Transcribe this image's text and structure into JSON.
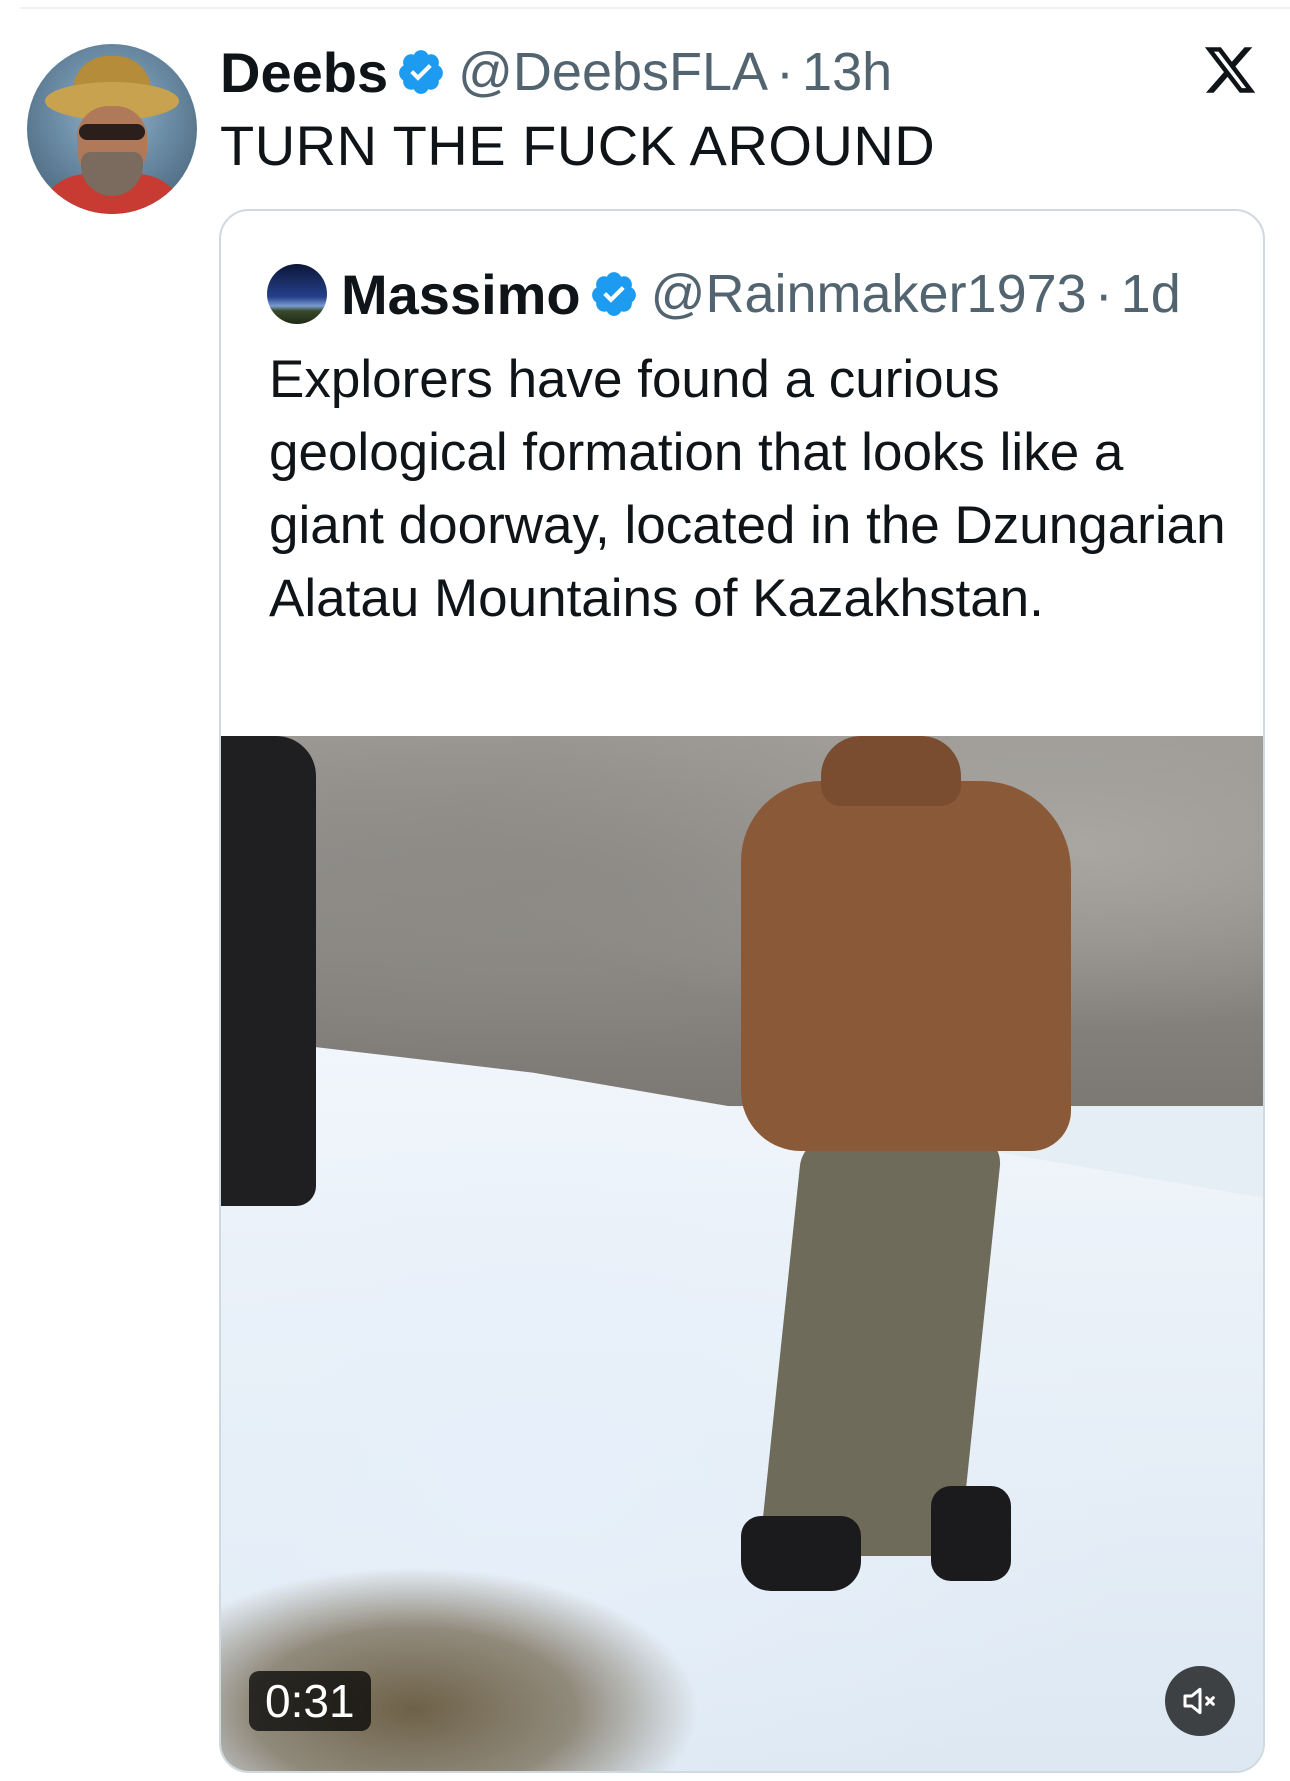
{
  "tweet": {
    "author_name": "Deebs",
    "author_handle": "@DeebsFLA",
    "separator": "·",
    "time": "13h",
    "text": "TURN THE FUCK AROUND"
  },
  "quote": {
    "author_name": "Massimo",
    "author_handle": "@Rainmaker1973",
    "separator": "·",
    "time": "1d",
    "text": "Explorers have found a curious geological formation that looks like a giant doorway, located in the Dzungarian Alatau Mountains of Kazakhstan.",
    "video": {
      "duration": "0:31",
      "muted": true
    }
  },
  "icons": {
    "verified": "verified-badge-icon",
    "close": "x-logo-icon",
    "mute": "speaker-muted-icon"
  },
  "colors": {
    "verified": "#1d9bf0",
    "text_primary": "#0f1419",
    "text_secondary": "#536471",
    "border": "#cfd9de"
  }
}
